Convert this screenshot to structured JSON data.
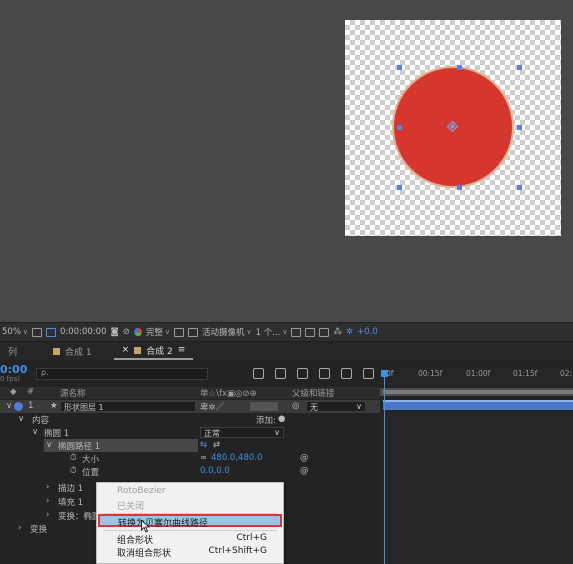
{
  "viewer": {
    "background": "#484848",
    "shape_fill": "#d5362d",
    "shape_stroke": "#e0b090",
    "handle_color": "#5b7ee0"
  },
  "toolbar": {
    "zoom": "50%",
    "timecode": "0:00:00:00",
    "resolution": "完整",
    "camera": "活动摄像机",
    "views": "1 个...",
    "exposure": "+0.0"
  },
  "tabs": [
    {
      "label": "列"
    },
    {
      "label": "合成 1"
    },
    {
      "label": "合成 2"
    }
  ],
  "timeline": {
    "timecode": "0:00",
    "fps": "0 fps)",
    "search_placeholder": "ρ.",
    "columns": {
      "number": "#",
      "source_name": "源名称",
      "switches": "单☆\\fx▣◎⊘⊕",
      "parent": "父级和链接"
    },
    "ruler": [
      "0f",
      "00:15f",
      "01:00f",
      "01:15f",
      "02:"
    ],
    "layer": {
      "number": "1",
      "name": "形状图层 1",
      "parent_value": "无"
    },
    "rows": {
      "contents": "内容",
      "add_label": "添加:",
      "ellipse_group": "椭圆 1",
      "blend_mode": "正常",
      "ellipse_path": "椭圆路径 1",
      "size_label": "大小",
      "size_value": "480.0,480.0",
      "position_label": "位置",
      "position_value": "0.0,0.0",
      "stroke": "描边 1",
      "fill": "填充 1",
      "transform_ellipse": "变换：椭圆",
      "transform": "变换"
    }
  },
  "context_menu": {
    "items": [
      {
        "label": "RotoBezier",
        "disabled": true
      },
      {
        "label": "已关闭",
        "disabled": true
      },
      {
        "label": "转换为贝塞尔曲线路径",
        "highlighted": true
      },
      {
        "label": "组合形状",
        "shortcut": "Ctrl+G"
      },
      {
        "label": "取消组合形状",
        "shortcut": "Ctrl+Shift+G"
      }
    ]
  }
}
